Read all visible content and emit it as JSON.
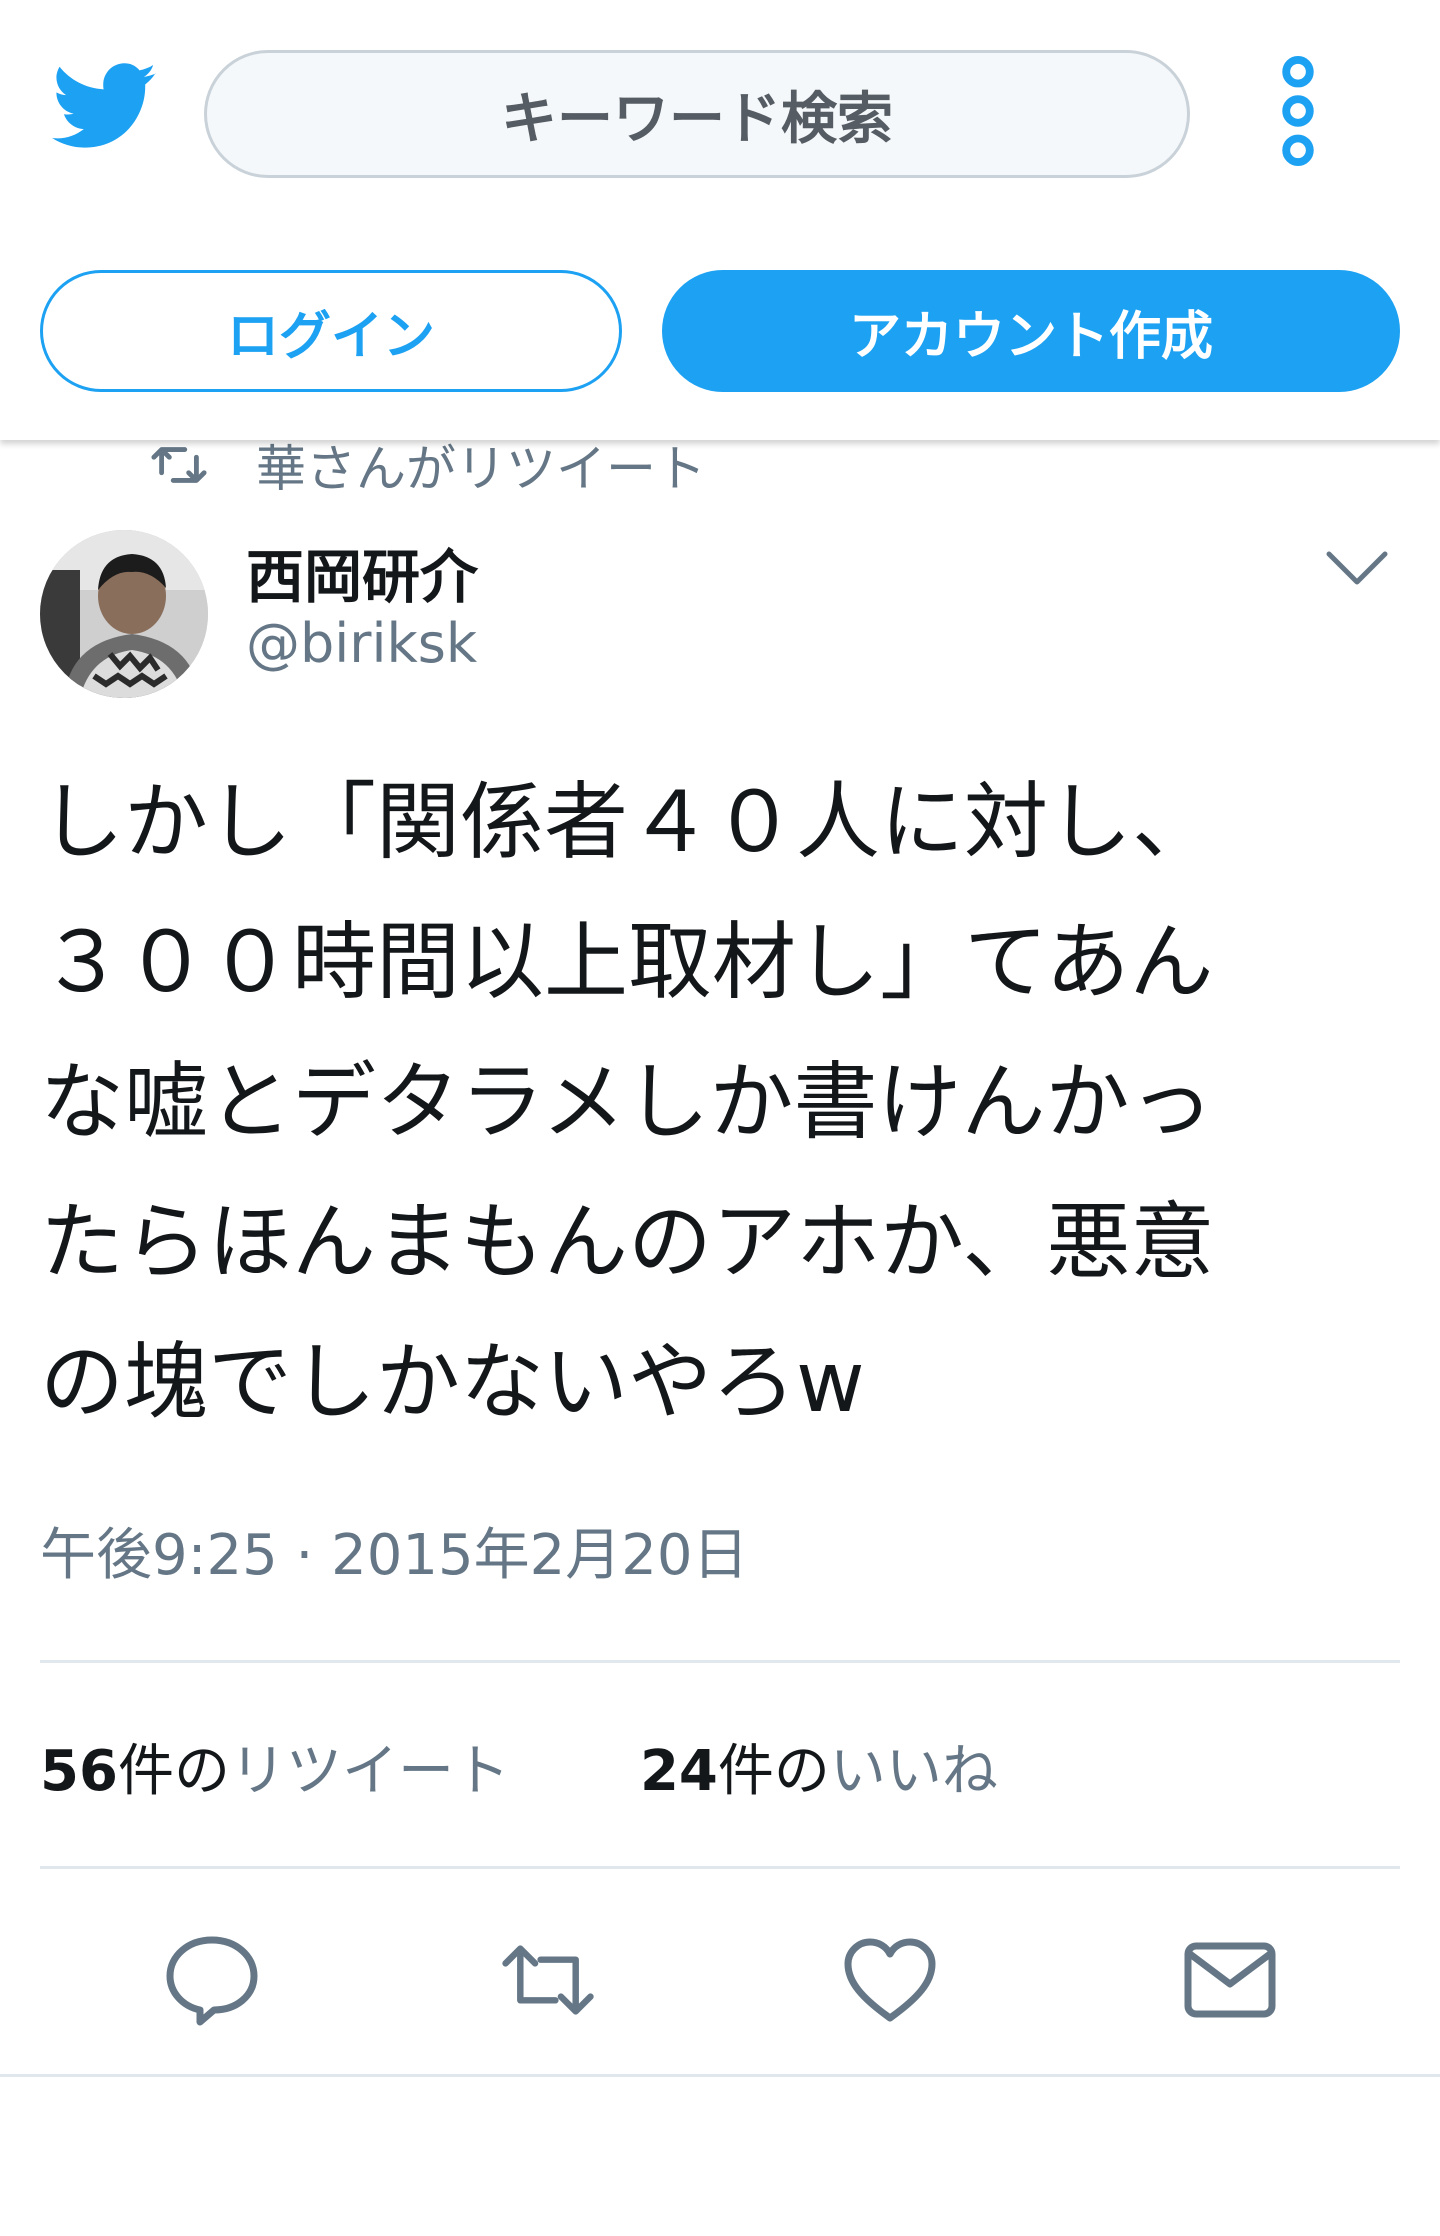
{
  "header": {
    "search_placeholder": "キーワード検索",
    "login_label": "ログイン",
    "signup_label": "アカウント作成"
  },
  "retweet_context": "華さんがリツイート",
  "tweet": {
    "display_name": "西岡研介",
    "handle": "@biriksk",
    "text_lines": [
      "しかし「関係者４０人に対し、",
      "３００時間以上取材し」てあん",
      "な嘘とデタラメしか書けんかっ",
      "たらほんまもんのアホか、悪意",
      "の塊でしかないやろw"
    ],
    "timestamp": "午後9:25 · 2015年2月20日",
    "retweets": {
      "count": "56",
      "of": "件の",
      "label": "リツイート"
    },
    "likes": {
      "count": "24",
      "of": "件の",
      "label": "いいね"
    }
  },
  "icons": {
    "logo": "twitter-bird-icon",
    "menu": "more-vertical-icon",
    "retweeted_by": "retweet-icon",
    "caret": "chevron-down-icon",
    "reply": "reply-icon",
    "retweet": "retweet-icon",
    "like": "heart-icon",
    "dm": "envelope-icon"
  },
  "colors": {
    "brand_blue": "#1da1f2",
    "secondary_text": "#657786",
    "divider": "#e1e8ed"
  }
}
